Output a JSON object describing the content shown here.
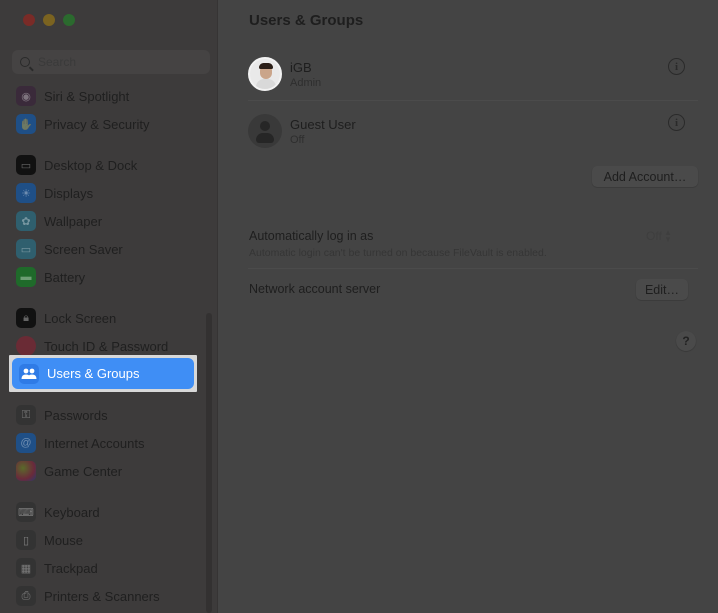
{
  "window": {
    "traffic_lights": [
      "close",
      "minimize",
      "zoom"
    ]
  },
  "sidebar": {
    "search_placeholder": "Search",
    "items": [
      {
        "label": "Siri & Spotlight",
        "icon": "siri-icon",
        "color": "#3a2a3a"
      },
      {
        "label": "Privacy & Security",
        "icon": "hand-icon",
        "color": "#1f4f86"
      },
      {
        "label": "Desktop & Dock",
        "icon": "dock-icon",
        "color": "#111111"
      },
      {
        "label": "Displays",
        "icon": "sun-icon",
        "color": "#1f4f86"
      },
      {
        "label": "Wallpaper",
        "icon": "wallpaper-icon",
        "color": "#2f5f6e"
      },
      {
        "label": "Screen Saver",
        "icon": "screensaver-icon",
        "color": "#2f5f6e"
      },
      {
        "label": "Battery",
        "icon": "battery-icon",
        "color": "#1f6a2a"
      },
      {
        "label": "Lock Screen",
        "icon": "lock-icon",
        "color": "#111111"
      },
      {
        "label": "Touch ID & Password",
        "icon": "fingerprint-icon",
        "color": "#6a2b35"
      },
      {
        "label": "Users & Groups",
        "icon": "users-icon",
        "color": "#2f7be6",
        "selected": true
      },
      {
        "label": "Passwords",
        "icon": "key-icon",
        "color": "#333333"
      },
      {
        "label": "Internet Accounts",
        "icon": "at-icon",
        "color": "#1f4f86"
      },
      {
        "label": "Game Center",
        "icon": "game-center-icon",
        "color": "#6a3a3a"
      },
      {
        "label": "Keyboard",
        "icon": "keyboard-icon",
        "color": "#333333"
      },
      {
        "label": "Mouse",
        "icon": "mouse-icon",
        "color": "#333333"
      },
      {
        "label": "Trackpad",
        "icon": "trackpad-icon",
        "color": "#333333"
      },
      {
        "label": "Printers & Scanners",
        "icon": "printer-icon",
        "color": "#333333"
      }
    ]
  },
  "main": {
    "title": "Users & Groups",
    "users": [
      {
        "name": "iGB",
        "role": "Admin",
        "avatar": "memoji-avatar"
      },
      {
        "name": "Guest User",
        "role": "Off",
        "avatar": "guest-avatar"
      }
    ],
    "info_glyph": "i",
    "add_account_label": "Add Account…",
    "auto_login": {
      "label": "Automatically log in as",
      "description": "Automatic login can't be turned on because FileVault is enabled.",
      "value": "Off"
    },
    "network_server": {
      "label": "Network account server",
      "button_label": "Edit…"
    },
    "help_glyph": "?"
  },
  "colors": {
    "selection_accent": "#3f8ef5",
    "highlight_border": "#d8d8d8"
  }
}
